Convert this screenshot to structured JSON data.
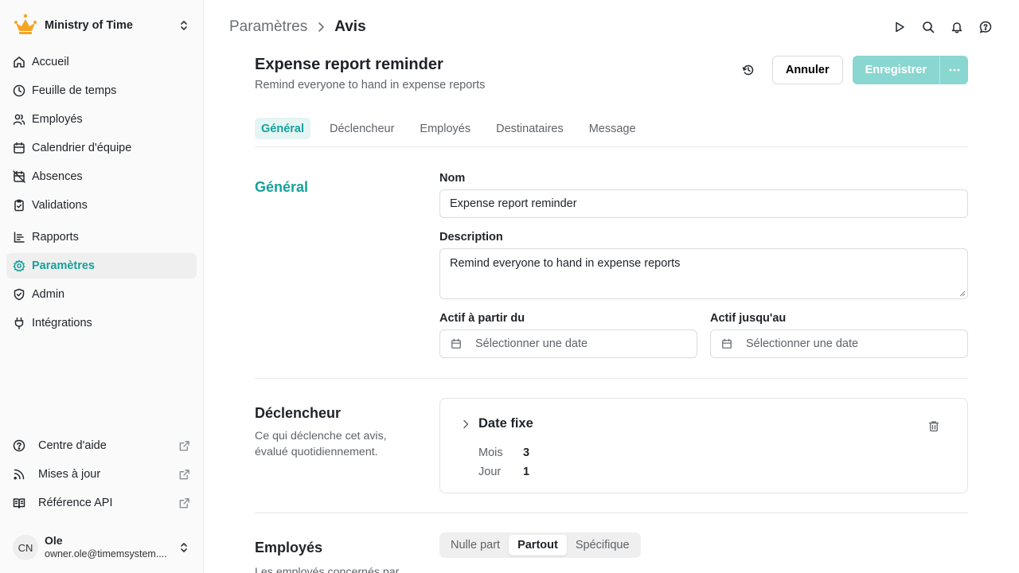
{
  "org": {
    "name": "Ministry of Time",
    "logo_icon": "crown-logo",
    "accent": "#14a29a",
    "logo_color": "#f5a524"
  },
  "sidebar": {
    "items": [
      {
        "label": "Accueil",
        "icon": "home-icon"
      },
      {
        "label": "Feuille de temps",
        "icon": "clock-icon"
      },
      {
        "label": "Employés",
        "icon": "users-icon"
      },
      {
        "label": "Calendrier d'équipe",
        "icon": "calendar-icon"
      },
      {
        "label": "Absences",
        "icon": "calendar-off-icon"
      },
      {
        "label": "Validations",
        "icon": "clipboard-check-icon"
      },
      {
        "label": "Rapports",
        "icon": "report-icon"
      },
      {
        "label": "Paramètres",
        "icon": "gear-icon",
        "active": true
      },
      {
        "label": "Admin",
        "icon": "shield-icon"
      },
      {
        "label": "Intégrations",
        "icon": "plug-icon"
      }
    ],
    "footer": [
      {
        "label": "Centre d'aide",
        "icon": "help-circle-icon"
      },
      {
        "label": "Mises à jour",
        "icon": "rss-icon"
      },
      {
        "label": "Référence API",
        "icon": "book-icon"
      }
    ],
    "user": {
      "initials": "CN",
      "name": "Ole",
      "email": "owner.ole@timemsystem...."
    }
  },
  "breadcrumb": {
    "parent": "Paramètres",
    "current": "Avis"
  },
  "header": {
    "title": "Expense report reminder",
    "subtitle": "Remind everyone to hand in expense reports",
    "cancel_label": "Annuler",
    "save_label": "Enregistrer"
  },
  "tabs": [
    "Général",
    "Déclencheur",
    "Employés",
    "Destinataires",
    "Message"
  ],
  "general": {
    "title": "Général",
    "name_label": "Nom",
    "name_value": "Expense report reminder",
    "description_label": "Description",
    "description_value": "Remind everyone to hand in expense reports",
    "active_from_label": "Actif à partir du",
    "active_until_label": "Actif jusqu'au",
    "date_placeholder": "Sélectionner une date"
  },
  "trigger": {
    "title": "Déclencheur",
    "description": "Ce qui déclenche cet avis, évalué quotidiennement.",
    "card_title": "Date fixe",
    "month_label": "Mois",
    "month_value": "3",
    "day_label": "Jour",
    "day_value": "1"
  },
  "employees": {
    "title": "Employés",
    "description": "Les employés concernés par",
    "options": [
      "Nulle part",
      "Partout",
      "Spécifique"
    ],
    "selected": "Partout"
  }
}
